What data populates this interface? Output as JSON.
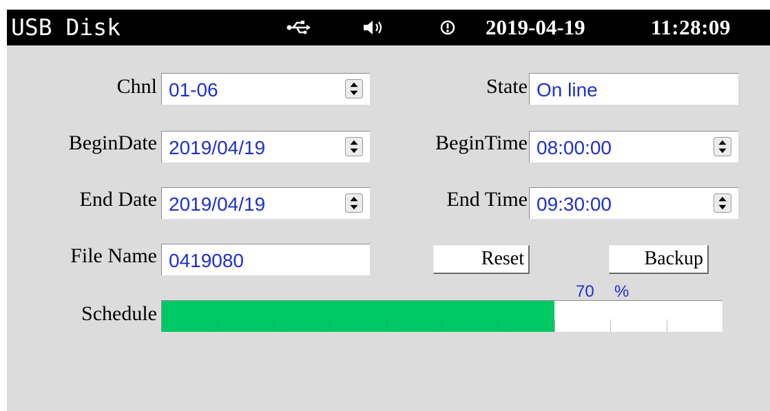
{
  "header": {
    "title": "USB Disk",
    "usb_icon": "usb-icon",
    "speaker_icon": "speaker-icon",
    "alarm_icon": "alert-icon",
    "date": "2019-04-19",
    "time": "11:28:09"
  },
  "form": {
    "chnl": {
      "label": "Chnl",
      "value": "01-06"
    },
    "state": {
      "label": "State",
      "value": "On line"
    },
    "begin_date": {
      "label": "BeginDate",
      "value": "2019/04/19"
    },
    "begin_time": {
      "label": "BeginTime",
      "value": "08:00:00"
    },
    "end_date": {
      "label": "End Date",
      "value": "2019/04/19"
    },
    "end_time": {
      "label": "End Time",
      "value": "09:30:00"
    },
    "file_name": {
      "label": "File Name",
      "value": "0419080"
    }
  },
  "buttons": {
    "reset": "Reset",
    "backup": "Backup"
  },
  "schedule": {
    "label": "Schedule",
    "percent_value": "70",
    "percent_sign": "%",
    "progress_fraction": 0.7,
    "segments": 10
  },
  "colors": {
    "header_bg": "#000000",
    "screen_bg": "#dcdcdc",
    "value_text": "#1f2fd0",
    "progress_fill": "#00c864"
  }
}
